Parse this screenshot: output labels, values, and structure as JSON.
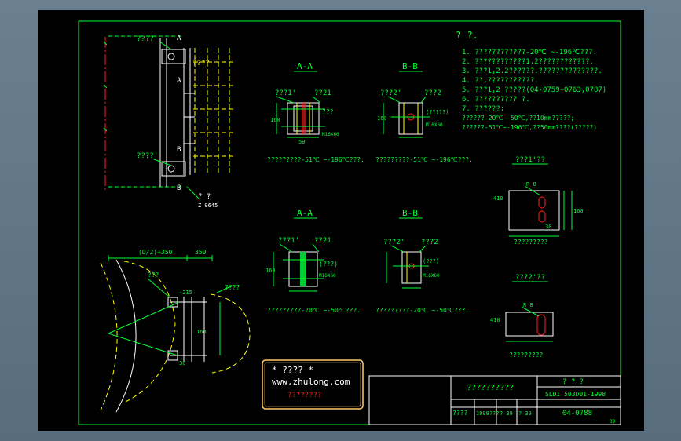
{
  "notes": {
    "title": "? ?.",
    "items": [
      "1.  ????????????-20℃ ~-196℃???.",
      "2.  ????????????1,2????????????.",
      "3.  ???1,2.2??????.??????????????.",
      "4.  ??,???????????.",
      "5.  ???1,2     ?????(04-0759~0763,0787)",
      "6.  ??????????  ?.",
      "7.  ??????;",
      "     ??????-20℃~-50℃,??10mm?????;",
      "     ??????-51℃~-196℃,??50mm????(?????)"
    ]
  },
  "sections": {
    "aa_top": "A-A",
    "bb_top": "B-B",
    "aa_bottom": "A-A",
    "bb_bottom": "B-B"
  },
  "labels": {
    "left_top_1": "????'",
    "left_top_2": "????",
    "left_mid": "????'",
    "left_bottom": "? ?",
    "left_bottom_2": "Z 9645",
    "cut_a": "A",
    "cut_b": "B",
    "aa1_left": "???1'",
    "aa1_right": "??21",
    "aa1_mid": "???",
    "aa1_bolt": "M16X60",
    "bb1_left": "???2'",
    "bb1_right": "???2",
    "bb1_mid": "(?????)",
    "bb1_bolt": "M16X60",
    "aa2_left": "???1'",
    "aa2_right": "??21",
    "aa2_mid": "(???)",
    "aa2_bolt": "M16X60",
    "bb2_left": "???2'",
    "bb2_right": "???2",
    "bb2_mid": "(???)",
    "bb2_bolt": "M16X60",
    "caption_aa1": "?????????-51℃ ~-196℃???.",
    "caption_bb1": "?????????-51℃ ~-196℃???.",
    "caption_aa2": "?????????-20℃ ~-50℃???.",
    "caption_bb2": "?????????-20℃ ~-50℃???.",
    "plate1_title": "???1'??",
    "plate1_caption": "?????????",
    "plate2_title": "???2'??",
    "plate2_caption": "?????????",
    "plan_dim_top": "(D/2)+350",
    "plan_dim_right": "350",
    "plan_label_1": "???",
    "plan_label_2": "????",
    "plan_dim_a": "-215",
    "plan_dim_b": "160",
    "plan_dim_c": "30",
    "dim_160": "160",
    "dim_50": "50",
    "dim_10": "10",
    "dim_60": "60",
    "dim_410": "410",
    "dim_30": "30",
    "dim_r8": "R 8"
  },
  "stamp": {
    "line1": "*  ????  *",
    "line2": "www.zhulong.com",
    "line3": "????????"
  },
  "titleblock": {
    "name": "??????????",
    "code_label": "?   ?   ?",
    "std": "SLDI 503D01-1998",
    "row_a": "????",
    "row_b": "1998???",
    "row_c": "? 39",
    "row_d": "? 39",
    "drawing_no": "04-0788",
    "sheet": "39"
  },
  "colors": {
    "line_white": "#ffffff",
    "line_green": "#00ff33",
    "line_yellow": "#ffff00",
    "line_cyan": "#00ffff",
    "line_red": "#ff2020",
    "stamp_border": "#ffcc66"
  }
}
